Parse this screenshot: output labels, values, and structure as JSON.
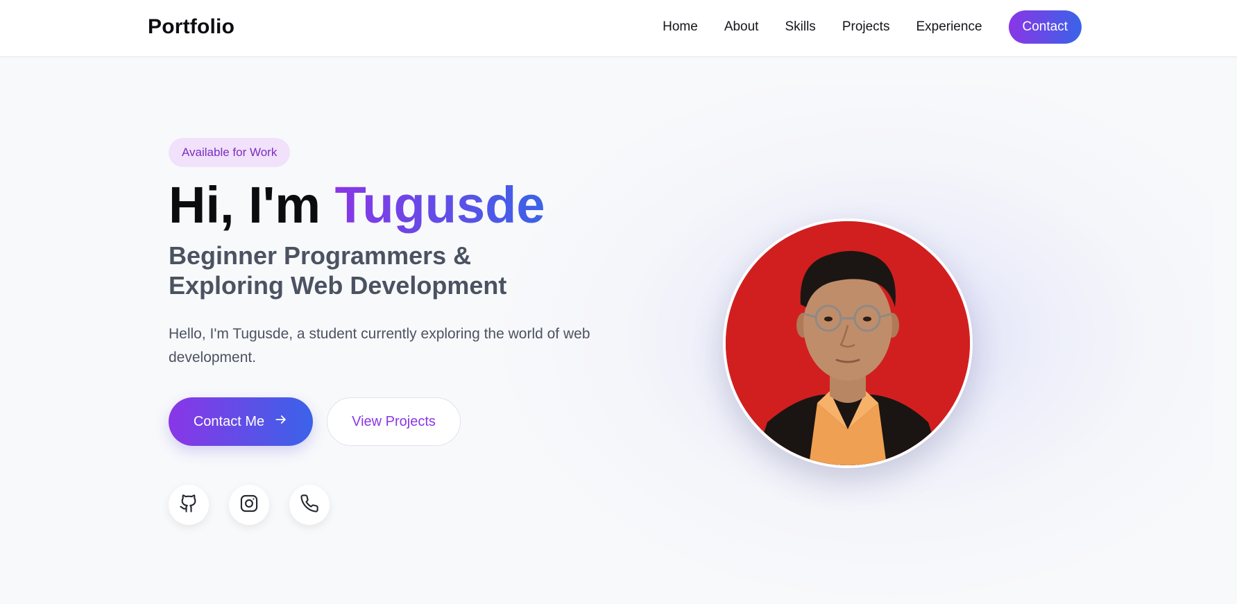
{
  "header": {
    "logo": "Portfolio",
    "nav": [
      {
        "label": "Home"
      },
      {
        "label": "About"
      },
      {
        "label": "Skills"
      },
      {
        "label": "Projects"
      },
      {
        "label": "Experience"
      }
    ],
    "cta_label": "Contact"
  },
  "hero": {
    "badge": "Available for Work",
    "greeting": "Hi, I'm ",
    "name": "Tugusde",
    "subtitle": "Beginner Programmers & Exploring Web Development",
    "intro": "Hello, I'm Tugusde, a student currently exploring the world of web development.",
    "primary_button": "Contact Me",
    "secondary_button": "View Projects",
    "socials": [
      {
        "icon": "github-icon"
      },
      {
        "icon": "instagram-icon"
      },
      {
        "icon": "phone-icon"
      }
    ]
  },
  "colors": {
    "gradient_start": "#8a36e6",
    "gradient_end": "#3a63e8",
    "badge_bg": "#f1e1fb",
    "badge_text": "#7a2ec0",
    "avatar_bg": "#d11f1f",
    "page_bg": "#f8f9fb"
  }
}
